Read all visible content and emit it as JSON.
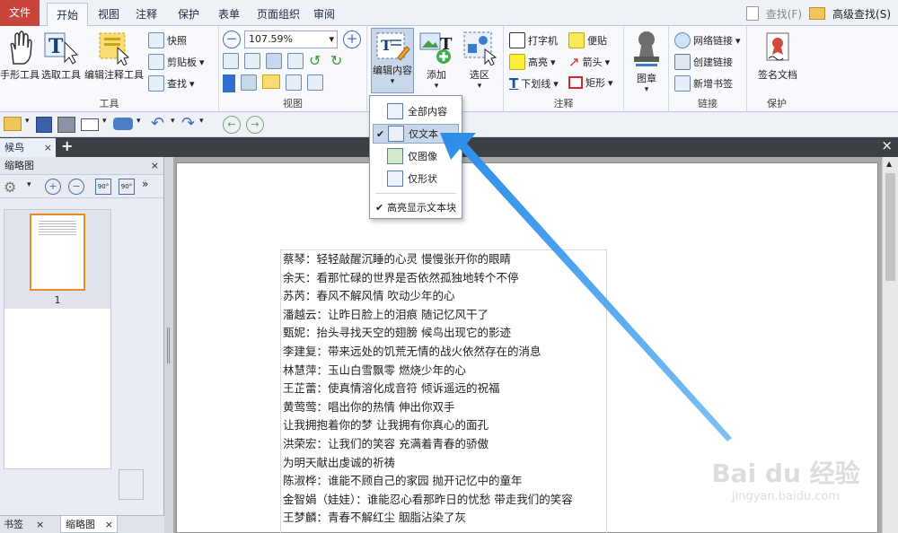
{
  "ribbon_tabs": [
    "文件",
    "开始",
    "视图",
    "注释",
    "保护",
    "表单",
    "页面组织",
    "审阅"
  ],
  "topright": {
    "find": "查找(F)",
    "advanced_find": "高级查找(S)"
  },
  "tools_group": {
    "hand": "手形工具",
    "select": "选取工具",
    "edit_annot": "编辑注释工具",
    "snapshot": "快照",
    "clipboard": "剪贴板",
    "find": "查找",
    "label": "工具"
  },
  "view_group": {
    "zoom": "107.59%",
    "label": "视图"
  },
  "edit_group": {
    "edit_content": "编辑内容",
    "add": "添加",
    "select_area": "选区"
  },
  "annot_group": {
    "typewriter": "打字机",
    "note": "便贴",
    "highlight": "高亮",
    "arrow": "箭头",
    "underline": "下划线",
    "rect": "矩形",
    "label": "注释"
  },
  "stamp_group": {
    "stamp": "图章"
  },
  "link_group": {
    "web_link": "网络链接",
    "create_link": "创建链接",
    "new_bookmark": "新增书签",
    "label": "链接"
  },
  "protect_group": {
    "sign": "签名文档",
    "label": "保护"
  },
  "doc_tab": "候鸟",
  "left_pane": {
    "title": "缩略图",
    "page_num": "1",
    "tab_bookmark": "书签",
    "tab_thumbs": "缩略图"
  },
  "dropdown": {
    "items": [
      "全部内容",
      "仅文本",
      "仅图像",
      "仅形状"
    ],
    "highlight_blocks": "高亮显示文本块"
  },
  "document_lines": [
    "蔡琴：轻轻敲醒沉睡的心灵 慢慢张开你的眼睛",
    "余天：看那忙碌的世界是否依然孤独地转个不停",
    "苏芮：春风不解风情 吹动少年的心",
    "潘越云：让昨日脸上的泪痕 随记忆风干了",
    "甄妮：抬头寻找天空的翅膀 候鸟出现它的影迹",
    "李建复：带来远处的饥荒无情的战火依然存在的消息",
    "林慧萍：玉山白雪飘零 燃烧少年的心",
    "王芷蕾：使真情溶化成音符 倾诉遥远的祝福",
    "黄莺莺：唱出你的热情 伸出你双手",
    "让我拥抱着你的梦 让我拥有你真心的面孔",
    "洪荣宏：让我们的笑容 充满着青春的骄傲",
    "为明天献出虔诚的祈祷",
    "陈淑桦：谁能不顾自己的家园 抛开记忆中的童年",
    "金智娟（娃娃）：谁能忍心看那昨日的忧愁 带走我们的笑容",
    "王梦麟：青春不解红尘 胭脂沾染了灰"
  ],
  "watermark": {
    "brand": "Bai du 经验",
    "url": "jingyan.baidu.com"
  }
}
